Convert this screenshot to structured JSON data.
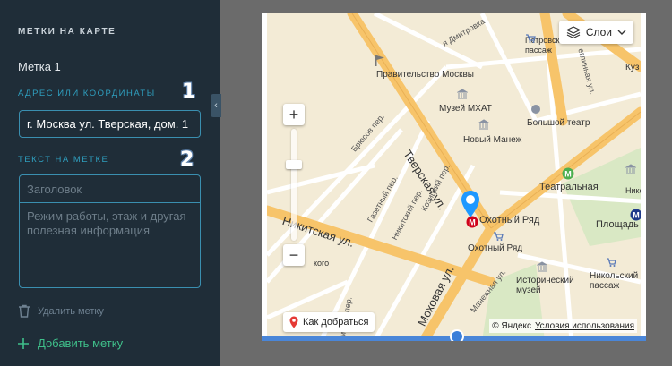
{
  "sidebar": {
    "title": "МЕТКИ НА КАРТЕ",
    "mark_name": "Метка 1",
    "address_label": "АДРЕС ИЛИ КООРДИНАТЫ",
    "address_badge": "1",
    "address_value": "г. Москва ул. Тверская, дом. 1",
    "text_label": "ТЕКСТ НА МЕТКЕ",
    "text_badge": "2",
    "title_placeholder": "Заголовок",
    "description_placeholder": "Режим работы, этаж и другая полезная информация",
    "delete_label": "Удалить метку",
    "add_label": "Добавить метку",
    "collapse_icon": "chevron-left-icon"
  },
  "map": {
    "layers_label": "Слои",
    "route_label": "Как добраться",
    "copyright": "© Яндекс",
    "terms": "Условия использования",
    "zoom_in": "+",
    "zoom_out": "−",
    "places": {
      "pravitelstvo": "Правительство Москвы",
      "mkhat": "Музей МХАТ",
      "bolshoi": "Большой театр",
      "novy_manezh": "Новый Манеж",
      "teatralnaya": "Театральная",
      "okhotny_ryad_metro": "Охотный Ряд",
      "okhotny_ryad_mall": "Охотный Ряд",
      "ploshchad_rev": "Площадь Рев",
      "istorichesky": "Исторический музей",
      "nikolsky": "Никольский пассаж",
      "petrovsky": "Петровский пассаж",
      "kuz": "Куз",
      "niko": "Нико",
      "tverskaya": "Тверская ул.",
      "mokhovaya": "Моховая ул.",
      "nikitskaya": "Никитская ул.",
      "bryusov": "Брюсов пер.",
      "gazetny": "Газетный пер.",
      "nikitsky": "Никитский пер.",
      "kozitsky": "Козицкий пер.",
      "manezhnaya": "Манежная ул.",
      "dmitrovka": "я Дмитровка",
      "neglinnaya": "еглинная ул.",
      "romanov": "оманов пер.",
      "kogo": "кого"
    }
  },
  "colors": {
    "sidebar_bg": "#1f2d38",
    "accent_blue": "#2f9fbf",
    "add_green": "#3fc08a",
    "metro_red": "#d0021b",
    "road_orange": "#f7c46a"
  }
}
